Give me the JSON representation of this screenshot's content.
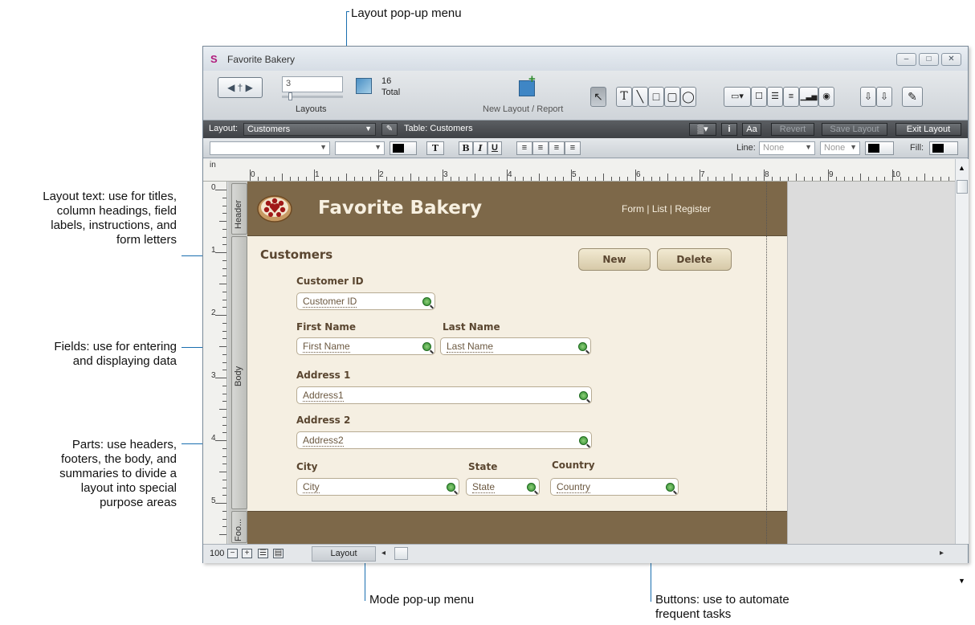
{
  "callouts": {
    "layout_menu": "Layout pop-up menu",
    "layout_text": [
      "Layout text: use for titles,",
      "column headings, field",
      "labels, instructions, and",
      "form letters"
    ],
    "fields": [
      "Fields: use for entering",
      "and displaying data"
    ],
    "parts": [
      "Parts: use headers,",
      "footers, the body, and",
      "summaries to divide a",
      "layout into special",
      "purpose areas"
    ],
    "mode_menu": "Mode pop-up menu",
    "buttons": [
      "Buttons: use to automate",
      "frequent tasks"
    ]
  },
  "window": {
    "title": "Favorite Bakery",
    "controls": [
      "–",
      "□",
      "✕"
    ]
  },
  "toolbar": {
    "book_glyph": "◀ † ▶",
    "record_value": "3",
    "layouts_label": "Layouts",
    "total_count": "16",
    "total_label": "Total",
    "new_layout_label": "New Layout / Report",
    "tools": [
      "↖",
      "T",
      "╲",
      "□",
      "▢",
      "◯",
      "▭▾",
      "☐",
      "☰",
      "≡",
      "▁▃▅",
      "◉",
      "⇩",
      "⇩",
      "✎"
    ]
  },
  "layout_bar": {
    "layout_label": "Layout:",
    "layout_value": "Customers",
    "pencil_glyph": "✎",
    "table_text": "Table: Customers",
    "grid_glyph": "▒▾",
    "info_glyph": "i",
    "aa_glyph": "Aa",
    "revert": "Revert",
    "save_layout": "Save Layout",
    "exit_layout": "Exit Layout"
  },
  "format_bar": {
    "bold": "B",
    "italic": "I",
    "underline": "U",
    "text_t": "T",
    "align_glyphs": [
      "≡",
      "≡",
      "≡",
      "≡"
    ],
    "line_label": "Line:",
    "line_value": "None",
    "line_pattern": "None",
    "fill_label": "Fill:"
  },
  "ruler": {
    "unit": "in",
    "h_numbers": [
      "0",
      "1",
      "2",
      "3",
      "4",
      "5",
      "6",
      "7",
      "8",
      "9",
      "10"
    ],
    "v_numbers": [
      "0",
      "1",
      "2",
      "3",
      "4",
      "5"
    ]
  },
  "parts": {
    "header": "Header",
    "body": "Body",
    "footer": "Foo..."
  },
  "layout": {
    "app_name": "Favorite Bakery",
    "nav": [
      "Form",
      "List",
      "Register"
    ],
    "nav_sep": "|",
    "section_title": "Customers",
    "buttons": {
      "new": "New",
      "delete": "Delete"
    },
    "fields": {
      "customer_id": {
        "label": "Customer ID",
        "value": "Customer ID"
      },
      "first_name": {
        "label": "First Name",
        "value": "First Name"
      },
      "last_name": {
        "label": "Last Name",
        "value": "Last Name"
      },
      "address1": {
        "label": "Address 1",
        "value": "Address1"
      },
      "address2": {
        "label": "Address 2",
        "value": "Address2"
      },
      "city": {
        "label": "City",
        "value": "City"
      },
      "state": {
        "label": "State",
        "value": "State"
      },
      "country": {
        "label": "Country",
        "value": "Country"
      }
    }
  },
  "bottom_bar": {
    "zoom": "100",
    "mode": "Layout",
    "left_arrow": "◂",
    "right_arrow": "▸"
  },
  "colors": {
    "accent_line": "#1a6fb0",
    "header_brown": "#7d6849",
    "body_cream": "#f5efe2"
  }
}
